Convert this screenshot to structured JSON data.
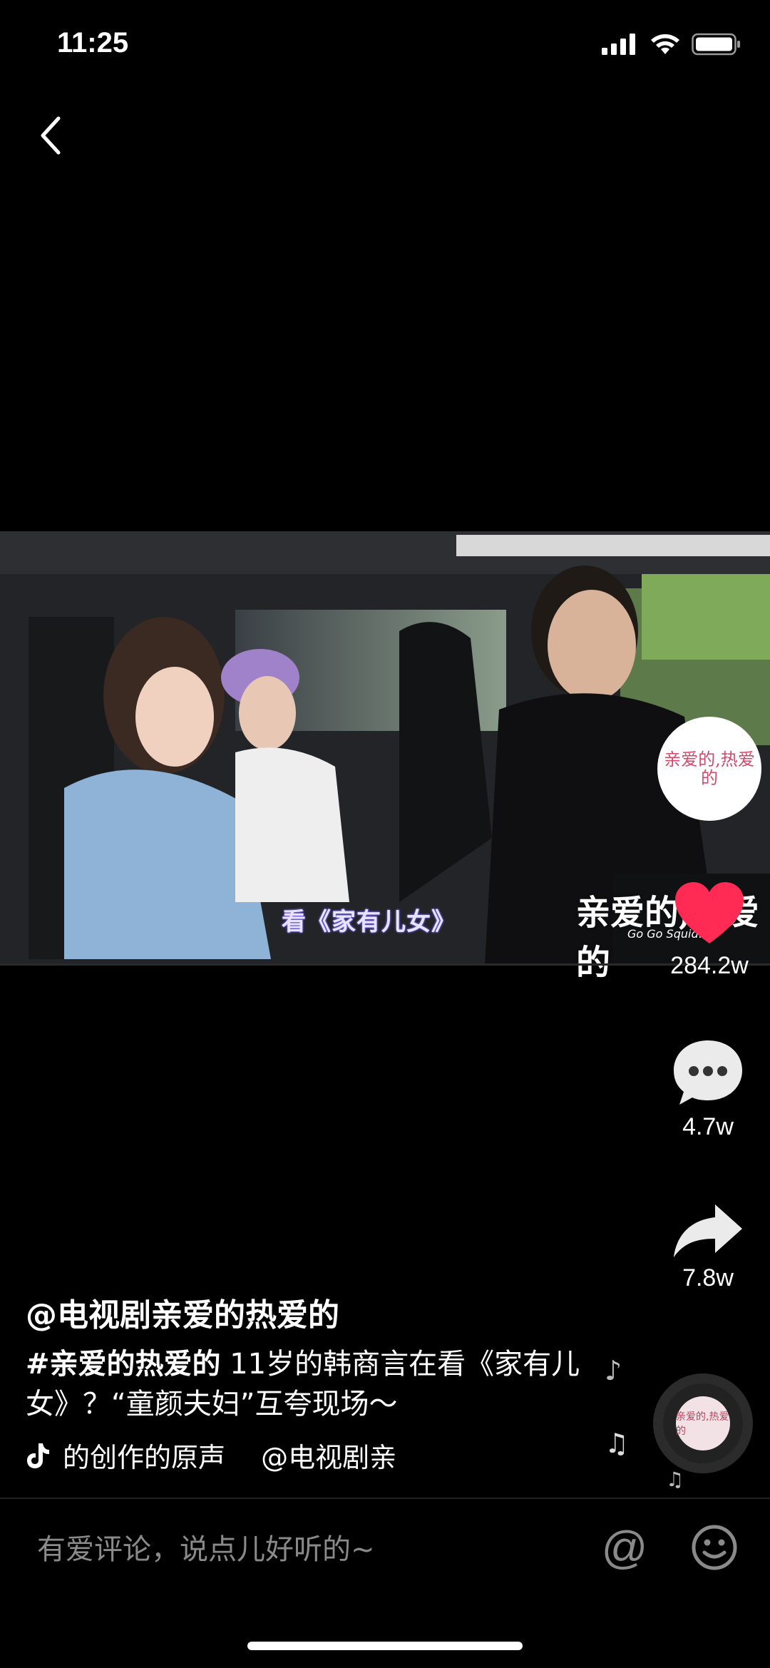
{
  "status_bar": {
    "time": "11:25"
  },
  "video": {
    "subtitle": "看《家有儿女》",
    "watermark": "亲爱的,热爱的",
    "watermark_sub": "Go Go Squid!",
    "progress": 0.0
  },
  "channel_avatar": {
    "text": "亲爱的,热爱的"
  },
  "actions": {
    "likes": "284.2w",
    "comments": "4.7w",
    "shares": "7.8w"
  },
  "post": {
    "author": "@电视剧亲爱的热爱的",
    "hashtag": "#亲爱的热爱的",
    "description": " 11岁的韩商言在看《家有儿女》？“童颜夫妇”互夸现场～",
    "music": "的创作的原声　 @电视剧亲"
  },
  "comment_bar": {
    "placeholder": "有爱评论，说点儿好听的~",
    "at_symbol": "@"
  },
  "colors": {
    "like": "#ff2b55",
    "progress": "#3ccf5a"
  },
  "icons": [
    "back-icon",
    "signal-icon",
    "wifi-icon",
    "battery-icon",
    "heart-icon",
    "comment-icon",
    "share-icon",
    "music-note-icon",
    "music-disc-icon",
    "at-icon",
    "emoji-icon"
  ]
}
